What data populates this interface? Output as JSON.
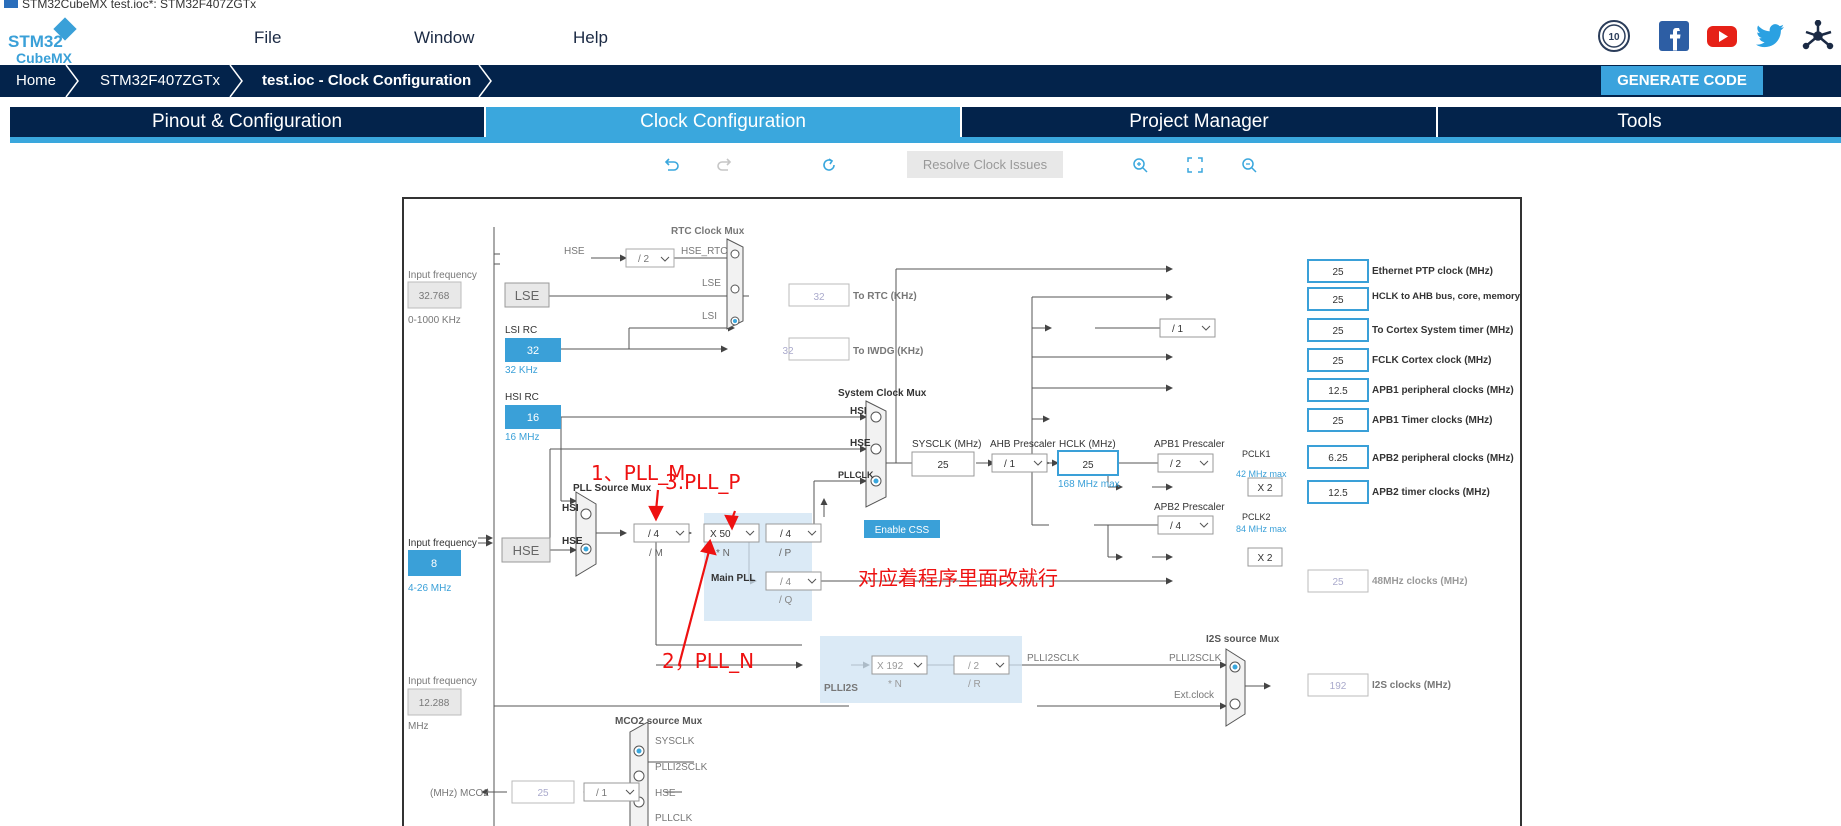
{
  "window": {
    "title": "STM32CubeMX test.ioc*: STM32F407ZGTx"
  },
  "app": {
    "logo_line1": "STM32",
    "logo_line2": "CubeMX"
  },
  "menu": [
    "File",
    "Window",
    "Help"
  ],
  "social_icons": [
    "anniversary-badge-icon",
    "facebook-icon",
    "youtube-icon",
    "twitter-icon",
    "network-icon"
  ],
  "breadcrumb": [
    "Home",
    "STM32F407ZGTx",
    "test.ioc - Clock Configuration"
  ],
  "generate_code": "GENERATE CODE",
  "tabs": [
    "Pinout & Configuration",
    "Clock Configuration",
    "Project Manager",
    "Tools"
  ],
  "active_tab": 1,
  "toolbar": {
    "resolve": "Resolve Clock Issues"
  },
  "clock": {
    "lse_input_label": "Input frequency",
    "lse_input_value": "32.768",
    "lse_range": "0-1000 KHz",
    "lse_label": "LSE",
    "lsi_label": "LSI RC",
    "lsi_value": "32",
    "lsi_unit": "32 KHz",
    "hsi_label": "HSI RC",
    "hsi_value": "16",
    "hsi_unit": "16 MHz",
    "hse_input_label": "Input frequency",
    "hse_input_value": "8",
    "hse_range": "4-26 MHz",
    "hse_label": "HSE",
    "ext_input_label": "Input frequency",
    "ext_input_value": "12.288",
    "ext_unit": "MHz",
    "rtc_mux_label": "RTC Clock Mux",
    "rtc_hse_label": "HSE",
    "rtc_div": "/ 2",
    "rtc_hse_rtc": "HSE_RTC",
    "rtc_lse": "LSE",
    "rtc_lsi": "LSI",
    "rtc_out_value": "32",
    "rtc_out_label": "To RTC (KHz)",
    "iwdg_value": "32",
    "iwdg_label": "To IWDG (KHz)",
    "sys_mux_label": "System Clock Mux",
    "sys_hsi": "HSI",
    "sys_hse": "HSE",
    "sys_pllclk": "PLLCLK",
    "pll_src_label": "PLL Source Mux",
    "pll_hsi": "HSI",
    "pll_hse": "HSE",
    "pll_m": "/ 4",
    "pll_m_label": "/ M",
    "pll_n": "X 50",
    "pll_n_label": "* N",
    "pll_p": "/ 4",
    "pll_p_label": "/ P",
    "pll_q": "/ 4",
    "pll_q_label": "/ Q",
    "main_pll_label": "Main PLL",
    "enable_css": "Enable CSS",
    "sysclk_label": "SYSCLK (MHz)",
    "sysclk_value": "25",
    "ahb_label": "AHB Prescaler",
    "ahb_value": "/ 1",
    "hclk_label": "HCLK (MHz)",
    "hclk_value": "25",
    "hclk_max": "168 MHz max",
    "cortex_div": "/ 1",
    "apb1_label": "APB1 Prescaler",
    "apb1_value": "/ 2",
    "pclk1_label": "PCLK1",
    "pclk1_max": "42 MHz max",
    "apb2_label": "APB2 Prescaler",
    "apb2_value": "/ 4",
    "pclk2_label": "PCLK2",
    "pclk2_max": "84 MHz max",
    "x2_a": "X 2",
    "x2_b": "X 2",
    "outputs": [
      {
        "value": "25",
        "label": "Ethernet PTP clock (MHz)"
      },
      {
        "value": "25",
        "label": "HCLK to AHB bus, core, memory and DMA (MHz)"
      },
      {
        "value": "25",
        "label": "To Cortex System timer (MHz)"
      },
      {
        "value": "25",
        "label": "FCLK Cortex clock (MHz)"
      },
      {
        "value": "12.5",
        "label": "APB1 peripheral clocks (MHz)"
      },
      {
        "value": "25",
        "label": "APB1 Timer clocks (MHz)"
      },
      {
        "value": "6.25",
        "label": "APB2 peripheral clocks (MHz)"
      },
      {
        "value": "12.5",
        "label": "APB2 timer clocks (MHz)"
      }
    ],
    "out48_value": "25",
    "out48_label": "48MHz clocks (MHz)",
    "plli2s_label": "PLLI2S",
    "plli2s_n": "X 192",
    "plli2s_n_label": "* N",
    "plli2s_r": "/ 2",
    "plli2s_r_label": "/ R",
    "plli2sclk": "PLLI2SCLK",
    "i2s_mux_label": "I2S source Mux",
    "i2s_plli2sclk": "PLLI2SCLK",
    "i2s_ext": "Ext.clock",
    "i2s_value": "192",
    "i2s_label": "I2S clocks (MHz)",
    "mco2_mux_label": "MCO2 source Mux",
    "mco2_sysclk": "SYSCLK",
    "mco2_plli2sclk": "PLLI2SCLK",
    "mco2_hse": "HSE",
    "mco2_pllclk": "PLLCLK",
    "mco2_label": "(MHz) MCO2",
    "mco2_value": "25",
    "mco2_div": "/ 1"
  },
  "annotations": {
    "pll_m": "1、PLL_M",
    "pll_n": "2，PLL_N",
    "pll_p": "3.PLL_P",
    "note": "对应着程序里面改就行"
  },
  "colors": {
    "navy": "#03234b",
    "accent": "#3aa7dd",
    "annotation": "#ee1111"
  }
}
